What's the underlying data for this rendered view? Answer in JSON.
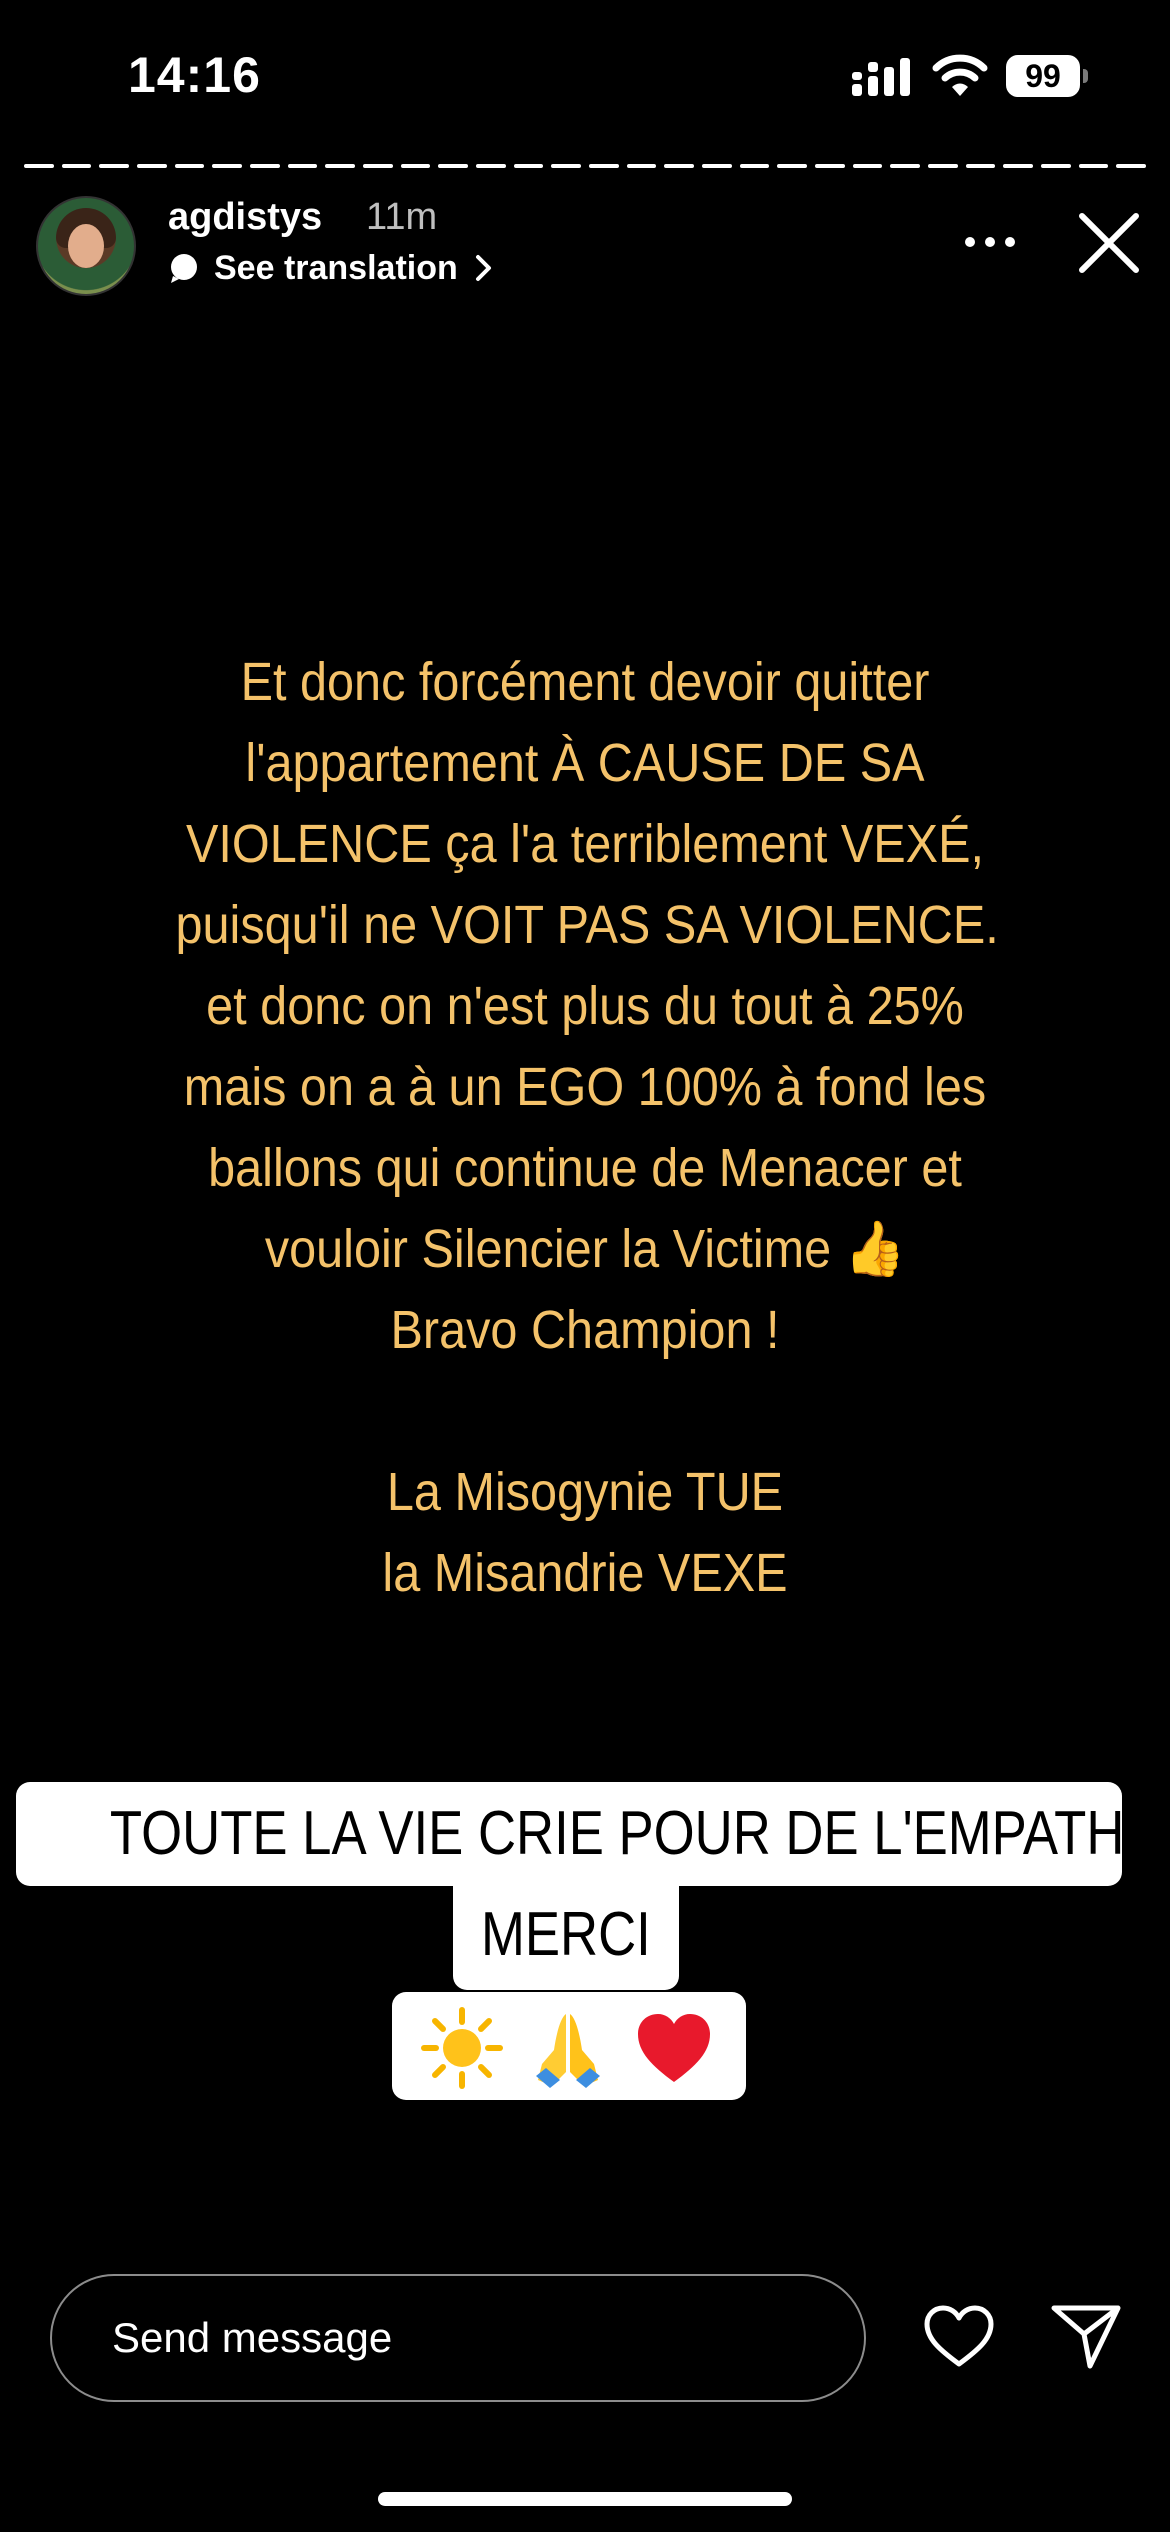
{
  "status_bar": {
    "time": "14:16",
    "battery": "99",
    "icons": [
      "signal-icon",
      "wifi-icon",
      "battery-icon"
    ]
  },
  "story_progress": {
    "segments_total": 30,
    "current_segment": 30
  },
  "header": {
    "username": "agdistys",
    "time_ago": "11m",
    "translate_label": "See translation",
    "icons": [
      "translate-icon",
      "chevron-right-icon",
      "more-icon",
      "close-icon"
    ]
  },
  "story": {
    "lines": [
      "Et donc forcément devoir quitter",
      "l'appartement À CAUSE DE SA",
      "VIOLENCE ça l'a terriblement VEXÉ,",
      "puisqu'il ne VOIT PAS SA VIOLENCE.",
      "et donc on n'est plus du tout à 25%",
      "mais on a à un EGO 100% à fond les",
      "ballons qui continue de Menacer et",
      "vouloir Silencier la Victime 👍",
      "Bravo Champion !"
    ],
    "closing_lines": [
      "La Misogynie TUE",
      "la Misandrie VEXE"
    ],
    "text_color": "#f4c26a",
    "sticker_line_1": "TOUTE LA VIE CRIE POUR DE L'EMPATHIE",
    "sticker_line_2": "MERCI",
    "sticker_emojis": [
      "sun-emoji",
      "folded-hands-emoji",
      "red-heart-emoji"
    ]
  },
  "footer": {
    "message_placeholder": "Send message",
    "icons": [
      "heart-icon",
      "send-icon"
    ]
  }
}
